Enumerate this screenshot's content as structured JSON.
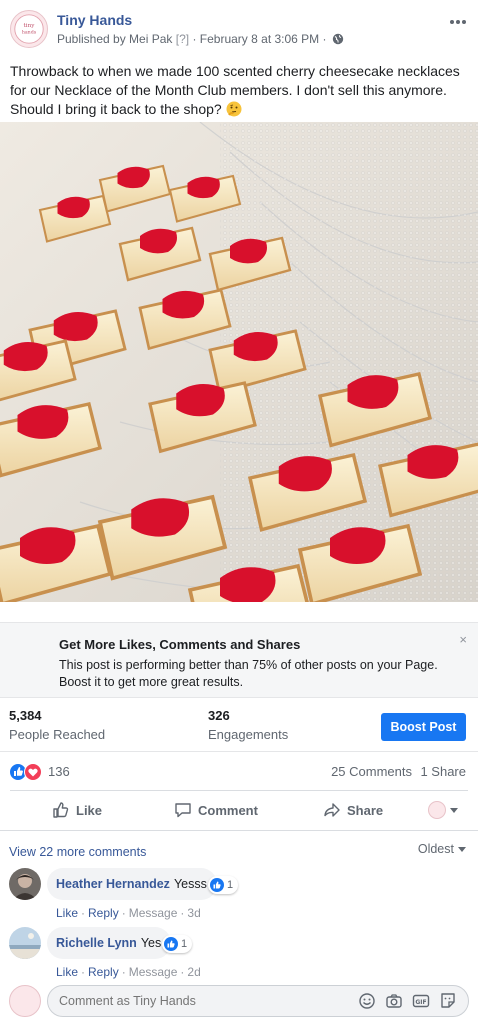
{
  "header": {
    "page_name": "Tiny Hands",
    "published_by": "Published by Mei Pak",
    "help_mark": "[?]",
    "timestamp": "February 8 at 3:06 PM",
    "separator": "·"
  },
  "post": {
    "text": "Throwback to when we made 100 scented cherry cheesecake necklaces for our Necklace of the Month Club members. I don't sell this anymore. Should I bring it back to the shop?",
    "emoji": "thinking-face-icon"
  },
  "boost_banner": {
    "title": "Get More Likes, Comments and Shares",
    "body": "This post is performing better than 75% of other posts on your Page. Boost it to get more great results.",
    "close": "×"
  },
  "stats": {
    "reached_value": "5,384",
    "reached_label": "People Reached",
    "engagements_value": "326",
    "engagements_label": "Engagements",
    "boost_button": "Boost Post"
  },
  "reactions": {
    "count": "136",
    "comments": "25 Comments",
    "shares": "1 Share",
    "types": [
      "like",
      "love"
    ],
    "colors": {
      "like": "#1877f2",
      "love": "#f33e58"
    }
  },
  "actions": {
    "like": "Like",
    "comment": "Comment",
    "share": "Share"
  },
  "comments": {
    "view_more": "View 22 more comments",
    "sort": "Oldest",
    "items": [
      {
        "name": "Heather Hernandez",
        "text": "Yesss",
        "likes": "1",
        "like": "Like",
        "reply": "Reply",
        "message": "Message",
        "time": "3d"
      },
      {
        "name": "Richelle Lynn",
        "text": "Yes",
        "likes": "1",
        "like": "Like",
        "reply": "Reply",
        "message": "Message",
        "time": "2d"
      }
    ],
    "composer_placeholder": "Comment as Tiny Hands",
    "composer_icons": [
      "emoji-icon",
      "camera-icon",
      "gif-icon",
      "sticker-icon"
    ]
  }
}
